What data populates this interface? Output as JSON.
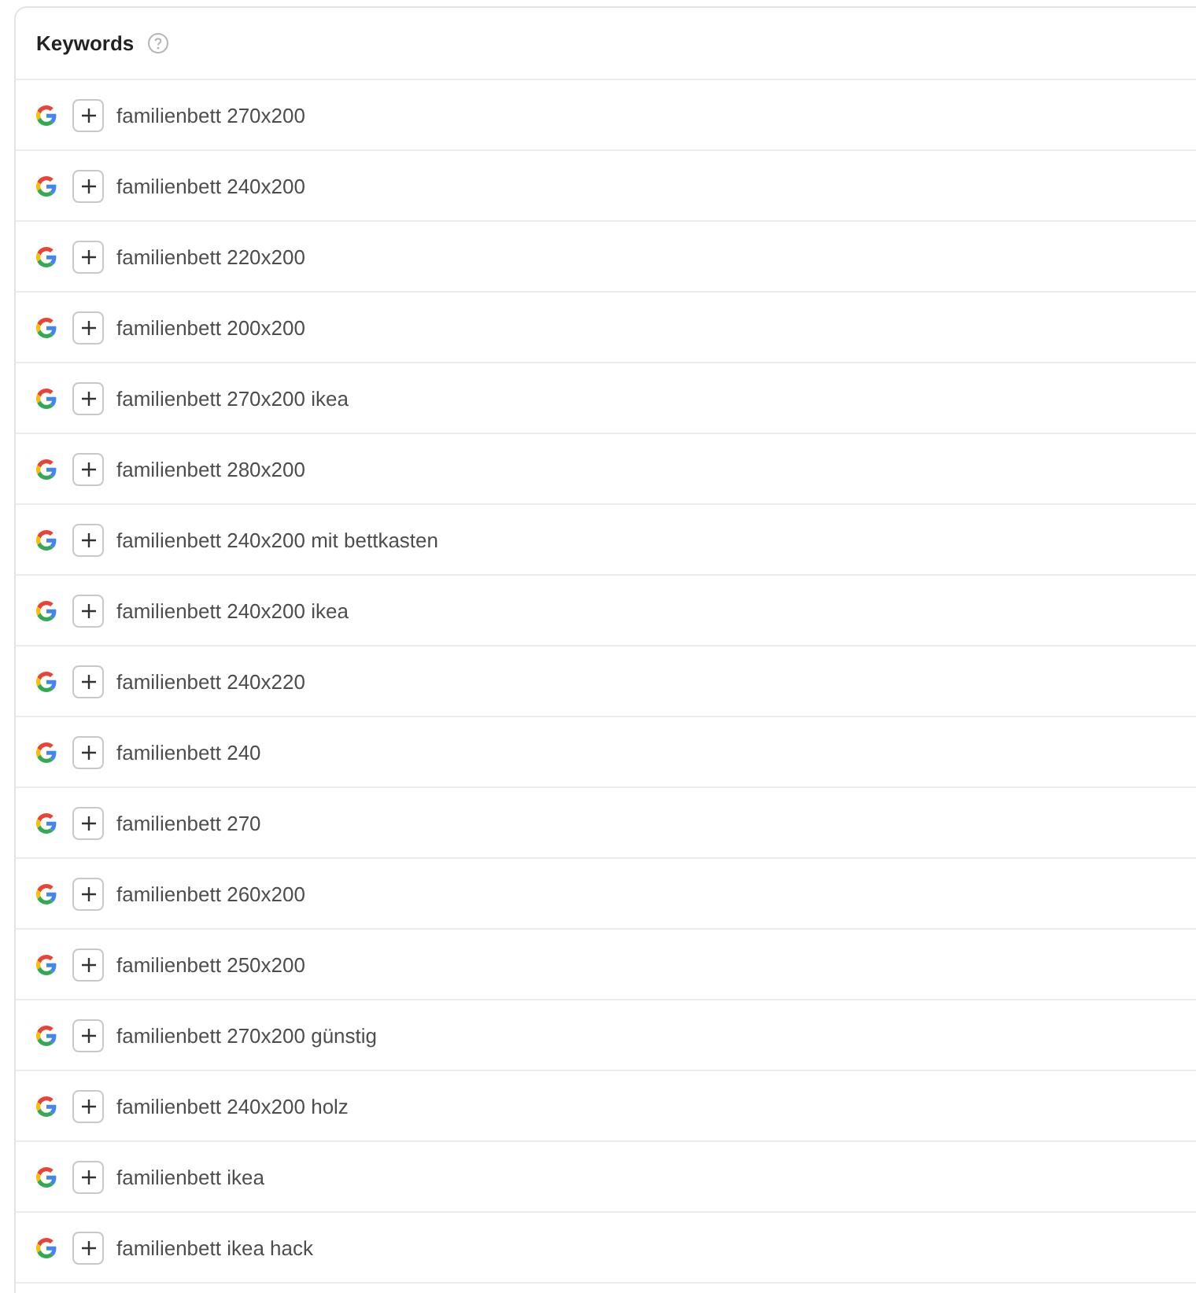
{
  "header": {
    "title": "Keywords"
  },
  "keywords": [
    {
      "text": "familienbett 270x200"
    },
    {
      "text": "familienbett 240x200"
    },
    {
      "text": "familienbett 220x200"
    },
    {
      "text": "familienbett 200x200"
    },
    {
      "text": "familienbett 270x200 ikea"
    },
    {
      "text": "familienbett 280x200"
    },
    {
      "text": "familienbett 240x200 mit bettkasten"
    },
    {
      "text": "familienbett 240x200 ikea"
    },
    {
      "text": "familienbett 240x220"
    },
    {
      "text": "familienbett 240"
    },
    {
      "text": "familienbett 270"
    },
    {
      "text": "familienbett 260x200"
    },
    {
      "text": "familienbett 250x200"
    },
    {
      "text": "familienbett 270x200 günstig"
    },
    {
      "text": "familienbett 240x200 holz"
    },
    {
      "text": "familienbett ikea"
    },
    {
      "text": "familienbett ikea hack"
    }
  ]
}
